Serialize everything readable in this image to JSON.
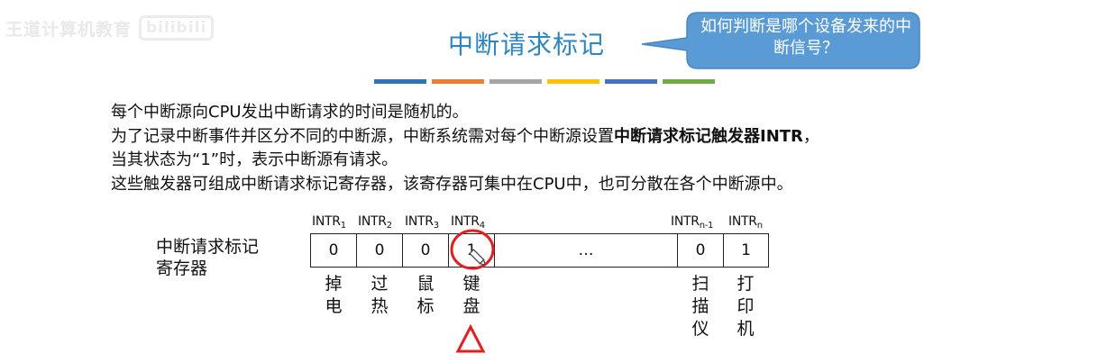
{
  "watermark": {
    "brand_text": "王道计算机教育",
    "logo_text": "bilibili"
  },
  "header": {
    "title": "中断请求标记"
  },
  "callout": {
    "text": "如何判断是哪个设备发来的中断信号？"
  },
  "color_bars": [
    "#2e75b6",
    "#ed7d31",
    "#a5a5a5",
    "#ffc000",
    "#4472c4",
    "#70ad47"
  ],
  "colors": {
    "title": "#2e86c1",
    "callout_fill": "#5b9bd5",
    "annotation_red": "#e02020"
  },
  "paragraph": {
    "line1": "每个中断源向CPU发出中断请求的时间是随机的。",
    "line2_pre": "为了记录中断事件并区分不同的中断源，中断系统需对每个中断源设置",
    "line2_bold": "中断请求标记触发器INTR",
    "line2_post": "，",
    "line3": "当其状态为“1”时，表示中断源有请求。",
    "line4": "这些触发器可组成中断请求标记寄存器，该寄存器可集中在CPU中，也可分散在各个中断源中。"
  },
  "register": {
    "label": "中断请求标记寄存器",
    "intr_prefix": "INTR",
    "cells": [
      {
        "sub": "1",
        "value": "0",
        "device": "掉电"
      },
      {
        "sub": "2",
        "value": "0",
        "device": "过热"
      },
      {
        "sub": "3",
        "value": "0",
        "device": "鼠标"
      },
      {
        "sub": "4",
        "value": "1",
        "device": "键盘"
      },
      {
        "sub": "",
        "value": "…",
        "device": ""
      },
      {
        "sub": "n-1",
        "value": "0",
        "device": "扫描仪"
      },
      {
        "sub": "n",
        "value": "1",
        "device": "打印机"
      }
    ]
  }
}
